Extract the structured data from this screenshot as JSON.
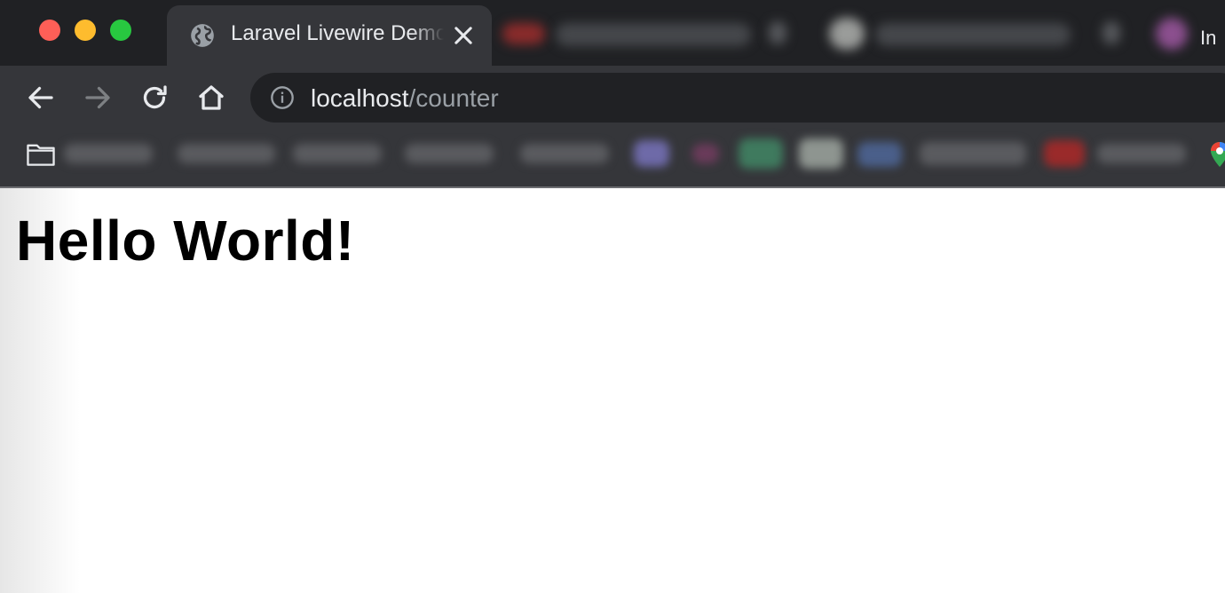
{
  "window": {
    "controls": [
      "close",
      "minimize",
      "zoom"
    ]
  },
  "tabs": {
    "active": {
      "title": "Laravel Livewire Demo",
      "icon": "globe-icon",
      "close_icon": "close-icon"
    },
    "partial_label": "In"
  },
  "toolbar": {
    "back_icon": "back-arrow-icon",
    "forward_icon": "forward-arrow-icon",
    "reload_icon": "reload-icon",
    "home_icon": "home-icon",
    "site_info_icon": "info-icon",
    "url_host": "localhost",
    "url_path": "/counter"
  },
  "bookmarks": {
    "folder_icon": "folder-icon"
  },
  "page": {
    "heading": "Hello World!"
  },
  "colors": {
    "titlebar": "#202124",
    "toolbar": "#35363a",
    "omnibox": "#202124",
    "text_primary": "#e8eaed",
    "text_secondary": "#9aa0a6",
    "page_bg": "#ffffff"
  }
}
